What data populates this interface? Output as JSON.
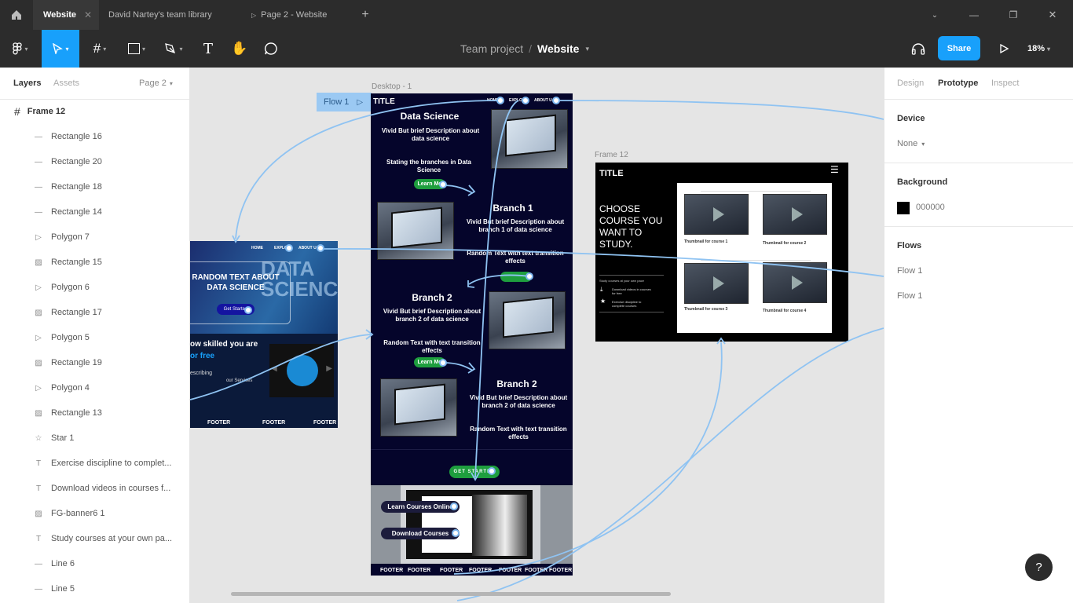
{
  "tabs": [
    {
      "label": "Website"
    },
    {
      "label": "David Nartey's team library"
    },
    {
      "label": "Page 2 - Website"
    }
  ],
  "toolbar": {
    "project": "Team project",
    "separator": "/",
    "file": "Website",
    "share": "Share",
    "zoom": "18%"
  },
  "left_panel": {
    "tab_layers": "Layers",
    "tab_assets": "Assets",
    "page": "Page 2",
    "frame": "Frame 12",
    "layers": [
      {
        "name": "Rectangle 16",
        "icon": "line-icon"
      },
      {
        "name": "Rectangle 20",
        "icon": "line-icon"
      },
      {
        "name": "Rectangle 18",
        "icon": "line-icon"
      },
      {
        "name": "Rectangle 14",
        "icon": "line-icon"
      },
      {
        "name": "Polygon 7",
        "icon": "polygon-icon"
      },
      {
        "name": "Rectangle 15",
        "icon": "image-icon"
      },
      {
        "name": "Polygon 6",
        "icon": "polygon-icon"
      },
      {
        "name": "Rectangle 17",
        "icon": "image-icon"
      },
      {
        "name": "Polygon 5",
        "icon": "polygon-icon"
      },
      {
        "name": "Rectangle 19",
        "icon": "image-icon"
      },
      {
        "name": "Polygon 4",
        "icon": "polygon-icon"
      },
      {
        "name": "Rectangle 13",
        "icon": "image-icon"
      },
      {
        "name": "Star 1",
        "icon": "star-icon"
      },
      {
        "name": "Exercise discipline to complet...",
        "icon": "text-icon"
      },
      {
        "name": "Download videos in courses f...",
        "icon": "text-icon"
      },
      {
        "name": "FG-banner6 1",
        "icon": "image-icon"
      },
      {
        "name": "Study courses at your own pa...",
        "icon": "text-icon"
      },
      {
        "name": "Line 6",
        "icon": "line-icon"
      },
      {
        "name": "Line 5",
        "icon": "line-icon"
      }
    ]
  },
  "right_panel": {
    "tab_design": "Design",
    "tab_prototype": "Prototype",
    "tab_inspect": "Inspect",
    "device_label": "Device",
    "device_value": "None",
    "background_label": "Background",
    "background_value": "000000",
    "flows_label": "Flows",
    "flows": [
      "Flow 1",
      "Flow 1"
    ]
  },
  "canvas": {
    "flow_tag": "Flow 1",
    "desktop_title": "Desktop - 1",
    "frame12_title": "Frame 12",
    "desktop": {
      "logo": "TITLE",
      "nav": [
        "HOME",
        "EXPLO",
        "ABOUT U"
      ],
      "s1_title": "Data Science",
      "s1_desc": "Vivid But brief Description about data science",
      "s1_sub": "Stating the branches in Data Science",
      "s1_btn": "Learn Mo",
      "s2_title": "Branch 1",
      "s2_desc": "Vivid But brief Description about branch 1 of data science",
      "s2_sub": "Random Text with text transition effects",
      "s3_title": "Branch 2",
      "s3_desc": "Vivid But brief Description about branch 2 of data science",
      "s3_sub": "Random Text with text transition effects",
      "s3_btn": "Learn Mo",
      "s4_title": "Branch 2",
      "s4_desc": "Vivid But brief Description about branch 2 of data science",
      "s4_sub": "Random Text with text transition effects",
      "cta": "GET STARTED",
      "pill1": "Learn Courses Online",
      "pill2": "Download Courses",
      "footer": [
        "FOOTER",
        "FOOTER",
        "FOOTER",
        "FOOTER",
        "FOOTER",
        "FOOTER",
        "FOOTER"
      ]
    },
    "mobile": {
      "nav": [
        "HOME",
        "EXPLO",
        "ABOUT U"
      ],
      "hero": "RANDOM TEXT ABOUT DATA SCIENCE",
      "hero_btn": "Get Started",
      "bg_word": "DATA SCIENCE",
      "skilled": "ow skilled you are",
      "free": "or free",
      "describing": "escribing",
      "services": "our Services",
      "footer": [
        "FOOTER",
        "FOOTER",
        "FOOTER"
      ]
    },
    "frame12": {
      "logo": "TITLE",
      "headline": "CHOOSE COURSE YOU WANT TO STUDY.",
      "study": "Study courses at your own pace",
      "download": "Download videos in courses for free",
      "exercise": "Exercise discipline to complete courses",
      "thumbs": [
        "Thumbnail for course 1",
        "Thumbnail for course 2",
        "Thumbnail for course 3",
        "Thumbnail for course 4"
      ]
    }
  },
  "help": "?"
}
